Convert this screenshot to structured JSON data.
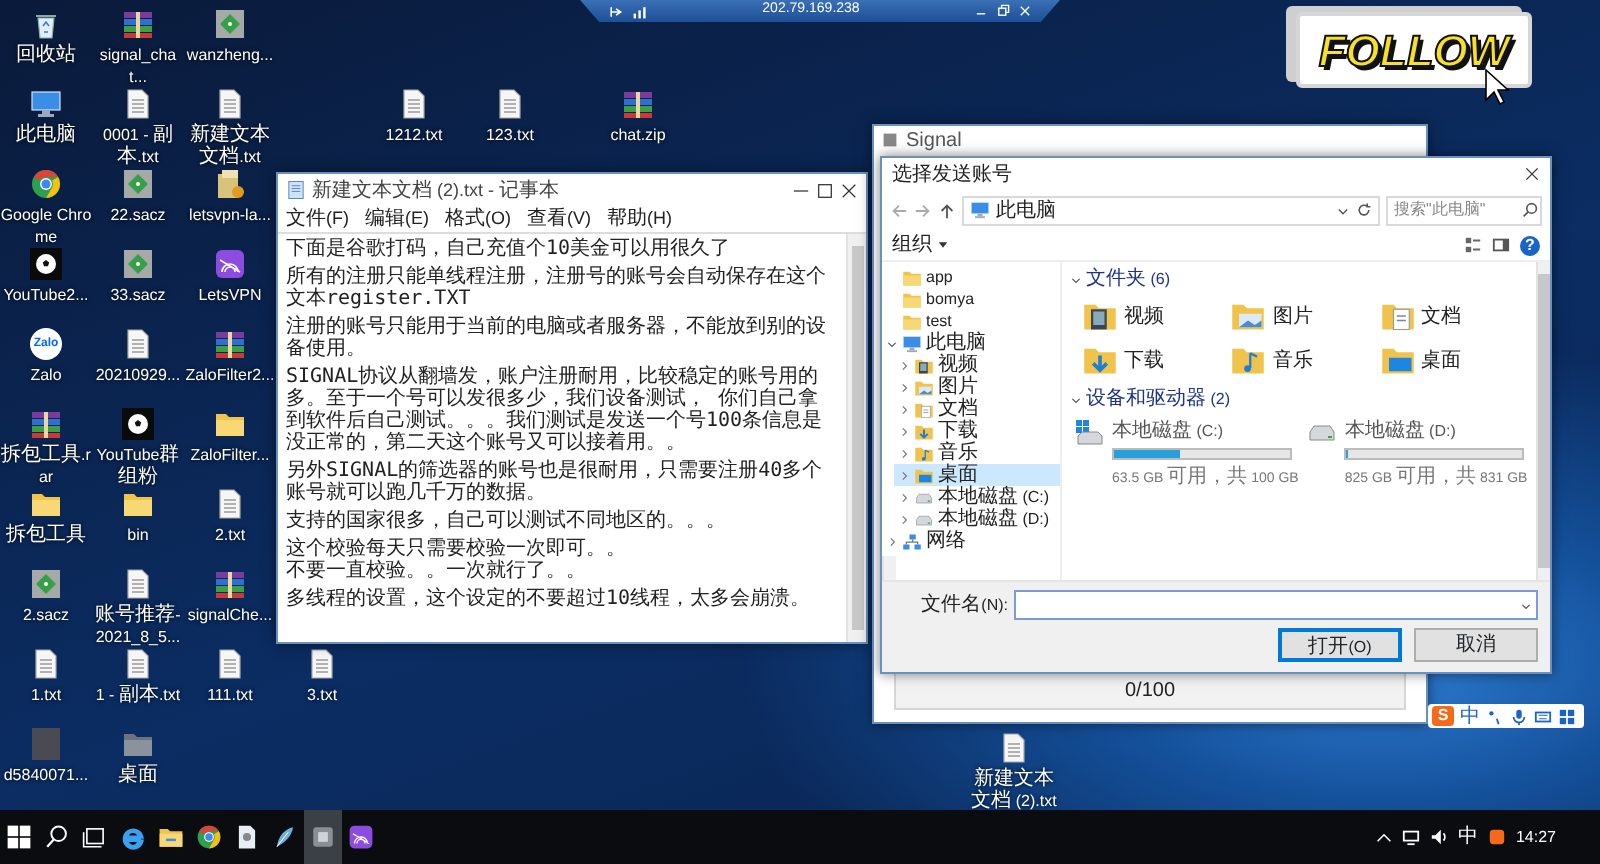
{
  "remote_bar": {
    "title": "202.79.169.238"
  },
  "follow_badge": {
    "label": "FOLLOW"
  },
  "desktop_icons": [
    {
      "label": "回收站",
      "kind": "recycle"
    },
    {
      "label": "signal_chat...",
      "kind": "archive"
    },
    {
      "label": "wanzheng...",
      "kind": "sacz"
    },
    {
      "label": "此电脑",
      "kind": "pc"
    },
    {
      "label": "0001 - 副本.txt",
      "kind": "txt"
    },
    {
      "label": "新建文本文档.txt",
      "kind": "txt"
    },
    {
      "label": "1212.txt",
      "kind": "txt"
    },
    {
      "label": "Google Chrome",
      "kind": "chrome"
    },
    {
      "label": "22.sacz",
      "kind": "sacz"
    },
    {
      "label": "letsvpn-la...",
      "kind": "installer"
    },
    {
      "label": "123.txt",
      "kind": "txt"
    },
    {
      "label": "YouTube2...",
      "kind": "ball"
    },
    {
      "label": "33.sacz",
      "kind": "sacz"
    },
    {
      "label": "LetsVPN",
      "kind": "vpn"
    },
    {
      "label": "chat.zip",
      "kind": "archive"
    },
    {
      "label": "Zalo",
      "kind": "zalo",
      "logo_text": "Zalo"
    },
    {
      "label": "20210929...",
      "kind": "txt"
    },
    {
      "label": "ZaloFilter2...",
      "kind": "archive"
    },
    {
      "label": "拆包工具.rar",
      "kind": "archive"
    },
    {
      "label": "YouTube群组粉",
      "kind": "ball"
    },
    {
      "label": "ZaloFilter...",
      "kind": "folder"
    },
    {
      "label": "拆包工具",
      "kind": "folder"
    },
    {
      "label": "bin",
      "kind": "folder"
    },
    {
      "label": "2.txt",
      "kind": "txt"
    },
    {
      "label": "2.sacz",
      "kind": "sacz"
    },
    {
      "label": "账号推荐-2021_8_5...",
      "kind": "txt"
    },
    {
      "label": "signalChe...",
      "kind": "archive"
    },
    {
      "label": "1.txt",
      "kind": "txt"
    },
    {
      "label": "1 - 副本.txt",
      "kind": "txt"
    },
    {
      "label": "111.txt",
      "kind": "txt"
    },
    {
      "label": "3.txt",
      "kind": "txt"
    },
    {
      "label": "d5840071...",
      "kind": "photo"
    },
    {
      "label": "桌面",
      "kind": "shortcut"
    },
    {
      "label": "新建文本文档 (2).txt",
      "kind": "txt"
    }
  ],
  "notepad": {
    "title": "新建文本文档 (2).txt - 记事本",
    "menu": [
      "文件(F)",
      "编辑(E)",
      "格式(O)",
      "查看(V)",
      "帮助(H)"
    ],
    "paragraphs": [
      {
        "lines": [
          "下面是谷歌打码，自己充值个10美金可以用很久了"
        ]
      },
      {
        "lines": [
          "所有的注册只能单线程注册，注册号的账号会自动保存在这个文本register.TXT"
        ]
      },
      {
        "lines": [
          "注册的账号只能用于当前的电脑或者服务器，不能放到别的设备使用。"
        ]
      },
      {
        "lines": [
          "SIGNAL协议从翻墙发，账户注册耐用，比较稳定的账号用的多。至于一个号可以发很多少，我们设备测试， 你们自己拿到软件后自己测试。。。我们测试是发送一个号100条信息是没正常的，第二天这个账号又可以接着用。。"
        ]
      },
      {
        "lines": [
          "另外SIGNAL的筛选器的账号也是很耐用，只需要注册40多个账号就可以跑几千万的数据。"
        ]
      },
      {
        "lines": [
          "支持的国家很多，自己可以测试不同地区的。。。"
        ]
      },
      {
        "lines": [
          "这个校验每天只需要校验一次即可。。",
          "不要一直校验。。一次就行了。。"
        ]
      },
      {
        "lines": [
          "多线程的设置，这个设定的不要超过10线程，太多会崩溃。"
        ]
      }
    ]
  },
  "signal_window": {
    "title": "Signal",
    "progress_text": "0/100"
  },
  "file_dialog": {
    "title": "选择发送账号",
    "breadcrumb": "此电脑",
    "search_placeholder": "搜索\"此电脑\"",
    "organize": "组织",
    "help": "?",
    "nav_tree": [
      {
        "label": "app",
        "kind": "folder",
        "selected": false
      },
      {
        "label": "bomya",
        "kind": "folder",
        "selected": false
      },
      {
        "label": "test",
        "kind": "folder",
        "selected": false
      },
      {
        "label": "此电脑",
        "kind": "pc",
        "selected": false,
        "expanded": true,
        "children": [
          {
            "label": "视频",
            "kind": "video",
            "selected": false,
            "expanded": false
          },
          {
            "label": "图片",
            "kind": "picture",
            "selected": false,
            "expanded": false
          },
          {
            "label": "文档",
            "kind": "document",
            "selected": false,
            "expanded": false
          },
          {
            "label": "下载",
            "kind": "download",
            "selected": false,
            "expanded": false
          },
          {
            "label": "音乐",
            "kind": "music",
            "selected": false,
            "expanded": false
          },
          {
            "label": "桌面",
            "kind": "desktop",
            "selected": true,
            "expanded": false
          },
          {
            "label": "本地磁盘 (C:)",
            "kind": "drive",
            "selected": false,
            "expanded": false
          },
          {
            "label": "本地磁盘 (D:)",
            "kind": "drive",
            "selected": false,
            "expanded": false
          }
        ]
      },
      {
        "label": "网络",
        "kind": "network",
        "selected": false,
        "expanded": false
      }
    ],
    "folders_group": {
      "title": "文件夹 (6)",
      "expanded": true,
      "items": [
        {
          "label": "视频",
          "kind": "video"
        },
        {
          "label": "图片",
          "kind": "picture"
        },
        {
          "label": "文档",
          "kind": "document"
        },
        {
          "label": "下载",
          "kind": "download"
        },
        {
          "label": "音乐",
          "kind": "music"
        },
        {
          "label": "桌面",
          "kind": "desktop"
        }
      ]
    },
    "drives_group": {
      "title": "设备和驱动器 (2)",
      "expanded": true,
      "items": [
        {
          "label": "本地磁盘 (C:)",
          "kind": "system",
          "level": 0.37,
          "detail": "63.5 GB 可用，共 100 GB"
        },
        {
          "label": "本地磁盘 (D:)",
          "kind": "drive",
          "level": 0.01,
          "detail": "825 GB 可用，共 831 GB"
        }
      ]
    },
    "filename_label": "文件名(N):",
    "buttons": [
      {
        "label": "打开(O)",
        "kind": "primary"
      },
      {
        "label": "取消",
        "kind": "default"
      }
    ]
  },
  "ime_bar": {
    "logo_text": "S",
    "mode": "中"
  },
  "taskbar": {
    "apps": [
      {
        "kind": "start",
        "selected": false
      },
      {
        "kind": "search",
        "selected": false
      },
      {
        "kind": "taskview",
        "selected": false
      },
      {
        "kind": "edge",
        "selected": false
      },
      {
        "kind": "explorer",
        "selected": false
      },
      {
        "kind": "chrome",
        "selected": false
      },
      {
        "kind": "document",
        "selected": false
      },
      {
        "kind": "feather",
        "selected": false
      },
      {
        "kind": "signal",
        "selected": true
      },
      {
        "kind": "vpn",
        "selected": false
      }
    ],
    "tray": {
      "ime": "中",
      "time": "14:27"
    }
  }
}
